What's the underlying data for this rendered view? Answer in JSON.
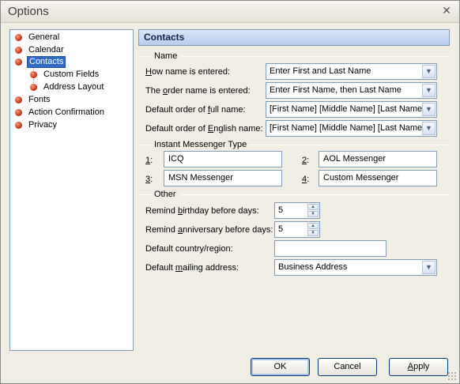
{
  "window": {
    "title": "Options",
    "close_glyph": "✕"
  },
  "tree": {
    "items": [
      {
        "label": "General"
      },
      {
        "label": "Calendar"
      },
      {
        "label": "Contacts"
      },
      {
        "label": "Custom Fields"
      },
      {
        "label": "Address Layout"
      },
      {
        "label": "Fonts"
      },
      {
        "label": "Action Confirmation"
      },
      {
        "label": "Privacy"
      }
    ],
    "selected": "Contacts"
  },
  "panel": {
    "header": "Contacts",
    "name_group": {
      "label": "Name",
      "fields": [
        {
          "label_pre": "",
          "label_u": "H",
          "label_post": "ow name is entered:",
          "value": "Enter First and Last Name"
        },
        {
          "label_pre": "The ",
          "label_u": "o",
          "label_post": "rder name is entered:",
          "value": "Enter First Name, then Last Name"
        },
        {
          "label_pre": "Default order of ",
          "label_u": "f",
          "label_post": "ull name:",
          "value": "[First Name] [Middle Name] [Last Name]"
        },
        {
          "label_pre": "Default order of ",
          "label_u": "E",
          "label_post": "nglish name:",
          "value": "[First Name] [Middle Name] [Last Name]"
        }
      ]
    },
    "im_group": {
      "label": "Instant Messenger Type",
      "entries": [
        {
          "num": "1",
          "suffix": ":",
          "value": "ICQ"
        },
        {
          "num": "2",
          "suffix": ":",
          "value": "AOL Messenger"
        },
        {
          "num": "3",
          "suffix": ":",
          "value": "MSN Messenger"
        },
        {
          "num": "4",
          "suffix": ":",
          "value": "Custom Messenger"
        }
      ]
    },
    "other_group": {
      "label": "Other",
      "birthday": {
        "label_pre": "Remind ",
        "label_u": "b",
        "label_post": "irthday before days:",
        "value": "5"
      },
      "anniversary": {
        "label_pre": "Remind ",
        "label_u": "a",
        "label_post": "nniversary before days:",
        "value": "5"
      },
      "country": {
        "label": "Default country/region:",
        "value": ""
      },
      "mailing": {
        "label_pre": "Default ",
        "label_u": "m",
        "label_post": "ailing address:",
        "value": "Business Address"
      }
    }
  },
  "buttons": {
    "ok": "OK",
    "cancel": "Cancel",
    "apply_u": "A",
    "apply_post": "pply"
  },
  "icons": {
    "dropdown": "▼",
    "spin_up": "▲",
    "spin_down": "▼",
    "tree_bullet": "red-ball-icon"
  },
  "colors": {
    "selection": "#316ac5",
    "header_band": "#c8d7f2",
    "bullet": "#c9391c"
  }
}
